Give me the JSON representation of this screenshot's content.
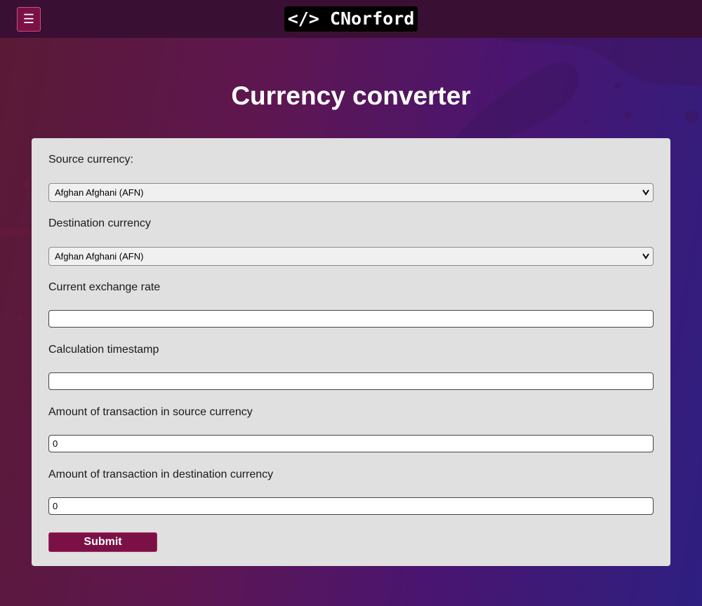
{
  "header": {
    "menu_icon": "hamburger-icon",
    "menu_glyph": "☰",
    "logo_text": "</> CNorford"
  },
  "main": {
    "title": "Currency converter"
  },
  "form": {
    "source_currency_label": "Source currency:",
    "source_currency_value": "Afghan Afghani (AFN)",
    "destination_currency_label": "Destination currency",
    "destination_currency_value": "Afghan Afghani (AFN)",
    "exchange_rate_label": "Current exchange rate",
    "exchange_rate_value": "",
    "timestamp_label": "Calculation timestamp",
    "timestamp_value": "",
    "source_amount_label": "Amount of transaction in source currency",
    "source_amount_value": "0",
    "destination_amount_label": "Amount of transaction in destination currency",
    "destination_amount_value": "0",
    "submit_label": "Submit"
  },
  "colors": {
    "topbar": "#3a0f34",
    "accent": "#7b1047",
    "card": "#e0e0e0"
  }
}
